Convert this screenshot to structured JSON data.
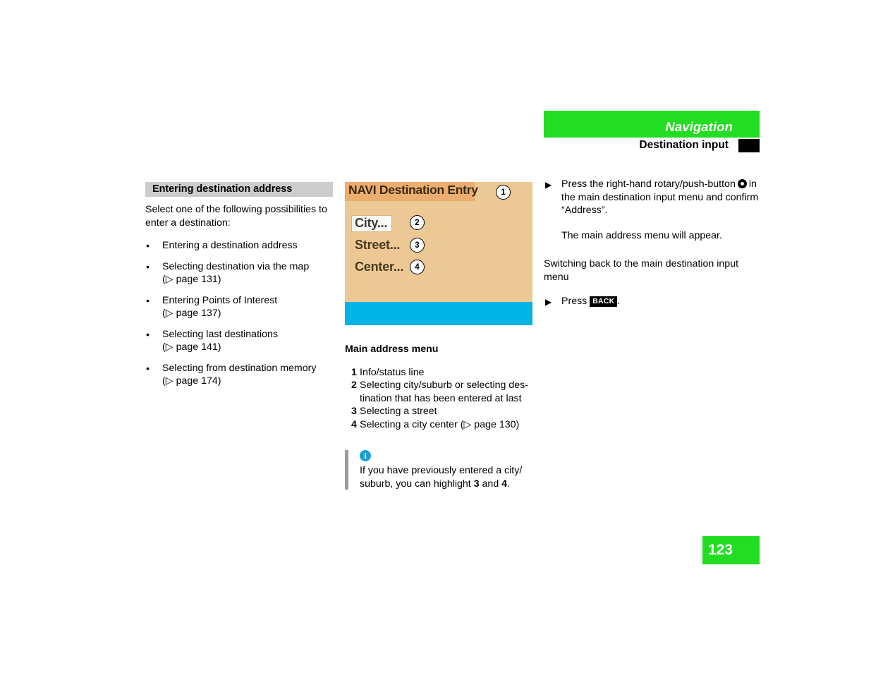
{
  "header": {
    "chapter_title": "Navigation",
    "section_title": "Destination input",
    "green": "#22DD22",
    "tab_color": "#000000"
  },
  "left_column": {
    "section_heading": "Entering destination address",
    "intro": "Select one of the following possibilities to enter a destination:",
    "bullet_marker": "•",
    "items": [
      {
        "text": "Entering a destination address",
        "ref": ""
      },
      {
        "text": "Selecting destination via the map",
        "ref": "(▷ page 131)"
      },
      {
        "text": "Entering Points of Interest",
        "ref": "(▷ page 137)"
      },
      {
        "text": "Selecting last destinations",
        "ref": "(▷ page 141)"
      },
      {
        "text": "Selecting from destination memory",
        "ref": "(▷ page 174)"
      }
    ]
  },
  "middle_column": {
    "screen": {
      "title": "NAVI Destination Entry",
      "items": [
        {
          "label": "City...",
          "selected": true
        },
        {
          "label": "Street...",
          "selected": false
        },
        {
          "label": "Center...",
          "selected": false
        }
      ],
      "callouts": [
        "1",
        "2",
        "3",
        "4"
      ],
      "title_bar_color": "#EBAE6E",
      "body_color": "#EBC894",
      "status_bar_color": "#00B4E6"
    },
    "figure_caption": "Main address menu",
    "legend": [
      {
        "num": "1",
        "text": "Info/status line"
      },
      {
        "num": "2",
        "text": "Selecting city/suburb or selecting des-tination that has been entered at last"
      },
      {
        "num": "3",
        "text": "Selecting a street"
      },
      {
        "num": "4",
        "text": "Selecting a city center (▷ page 130)"
      }
    ],
    "legend_line_2a": "Selecting city/suburb or selecting des-",
    "legend_line_2b": "tination that has been entered at last",
    "note": {
      "icon": "i",
      "line1": "If you have previously entered a city/",
      "line2_pre": "suburb, you can highlight ",
      "line2_bold1": "3",
      "line2_mid": " and ",
      "line2_bold2": "4",
      "line2_post": "."
    }
  },
  "right_column": {
    "triangle_marker": "▶",
    "step1_pre": "Press the right-hand rotary/push-button",
    "step1_post": "in the main destination input menu and confirm “Address”.",
    "step1_result": "The main address menu will appear.",
    "paragraph": "Switching back to the main destination input menu",
    "step2_pre": "Press",
    "step2_key": "BACK",
    "step2_post": "."
  },
  "page_number": "123"
}
